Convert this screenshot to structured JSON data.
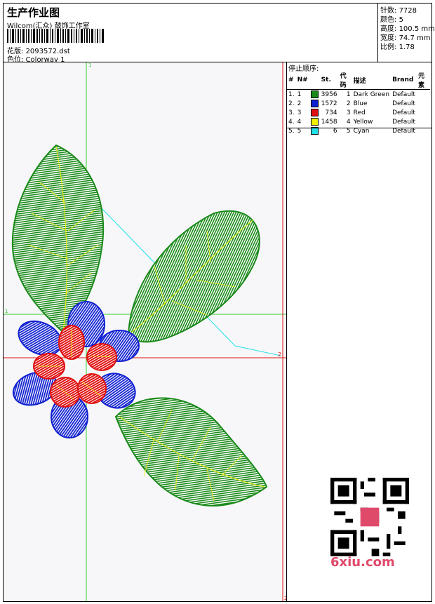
{
  "header": {
    "title": "生产作业图",
    "company": "Wilcom(汇众) 鼓饰工作室",
    "design_label": "花版:",
    "design_value": "2093572.dst",
    "colorway_label": "色位:",
    "colorway_value": "Colorway 1"
  },
  "stats": {
    "stitches_label": "针数:",
    "stitches_value": "7728",
    "colors_label": "颜色:",
    "colors_value": "5",
    "height_label": "高度:",
    "height_value": "100.5 mm",
    "width_label": "宽度:",
    "width_value": "74.7 mm",
    "ratio_label": "比例:",
    "ratio_value": "1.78"
  },
  "sequence": {
    "heading": "停止顺序:",
    "columns": [
      "#",
      "N#",
      "",
      "St.",
      "代码",
      "描述",
      "Brand",
      "元素"
    ],
    "rows": [
      {
        "idx": "1.",
        "n": "1",
        "color": "#1a8a1a",
        "st": "3956",
        "code": "1",
        "desc": "Dark Green",
        "brand": "Default"
      },
      {
        "idx": "2.",
        "n": "2",
        "color": "#1020d0",
        "st": "1572",
        "code": "2",
        "desc": "Blue",
        "brand": "Default"
      },
      {
        "idx": "3.",
        "n": "3",
        "color": "#e01010",
        "st": "734",
        "code": "3",
        "desc": "Red",
        "brand": "Default"
      },
      {
        "idx": "4.",
        "n": "4",
        "color": "#f0f000",
        "st": "1458",
        "code": "4",
        "desc": "Yellow",
        "brand": "Default"
      },
      {
        "idx": "5.",
        "n": "5",
        "color": "#20e0e8",
        "st": "6",
        "code": "5",
        "desc": "Cyan",
        "brand": "Default"
      }
    ]
  },
  "canvas": {
    "marker_top": "1",
    "marker_left": "1",
    "marker_right": "2",
    "marker_bottom": "2"
  },
  "watermark": {
    "text": "6xiu.com"
  },
  "colors": {
    "green": "#1a8a1a",
    "blue": "#1020d0",
    "red": "#e01010",
    "yellow": "#f0f000",
    "cyan": "#20e0e8",
    "guide_green": "#33cc33",
    "guide_red": "#e01010"
  }
}
